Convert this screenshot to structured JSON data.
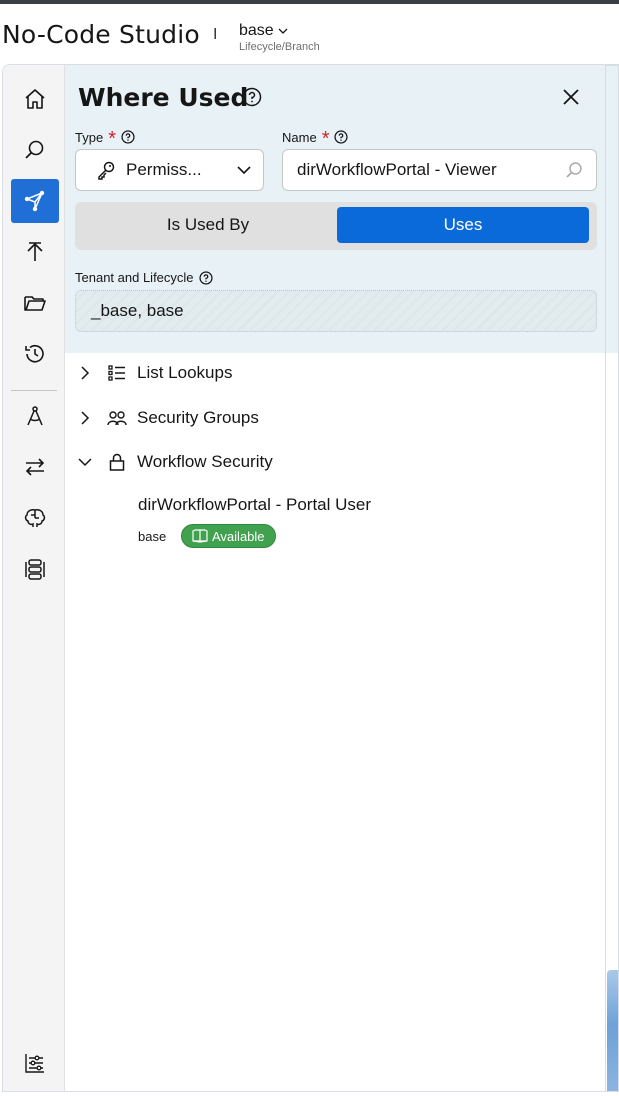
{
  "header": {
    "app_title": "No-Code Studio",
    "separator": "I",
    "branch": "base",
    "branch_sub": "Lifecycle/Branch"
  },
  "rail": {
    "items": [
      {
        "icon": "home-icon",
        "active": false
      },
      {
        "icon": "search-icon",
        "active": false
      },
      {
        "icon": "where-used-icon",
        "active": true
      },
      {
        "icon": "deploy-icon",
        "active": false
      },
      {
        "icon": "folder-icon",
        "active": false
      },
      {
        "icon": "history-icon",
        "active": false
      },
      {
        "icon": "compass-icon",
        "active": false
      },
      {
        "icon": "transfer-icon",
        "active": false
      },
      {
        "icon": "brain-icon",
        "active": false
      },
      {
        "icon": "flow-icon",
        "active": false
      }
    ],
    "settings_icon": "settings-sliders-icon"
  },
  "panel": {
    "title": "Where Used",
    "type_label": "Type",
    "type_value": "Permiss...",
    "name_label": "Name",
    "name_value": "dirWorkflowPortal - Viewer",
    "toggle": {
      "left": "Is Used By",
      "right": "Uses",
      "selected": "Uses"
    },
    "tenant_label": "Tenant and Lifecycle",
    "tenant_value": "_base, base"
  },
  "tree": {
    "nodes": [
      {
        "label": "List Lookups",
        "expanded": false
      },
      {
        "label": "Security Groups",
        "expanded": false
      },
      {
        "label": "Workflow Security",
        "expanded": true
      }
    ],
    "child": {
      "name": "dirWorkflowPortal - Portal User",
      "branch": "base",
      "status": "Available"
    }
  },
  "colors": {
    "accent": "#0b6ad9",
    "panel_bg": "#e8f2f6",
    "required": "#da1e28",
    "badge_green": "#42a14f"
  }
}
